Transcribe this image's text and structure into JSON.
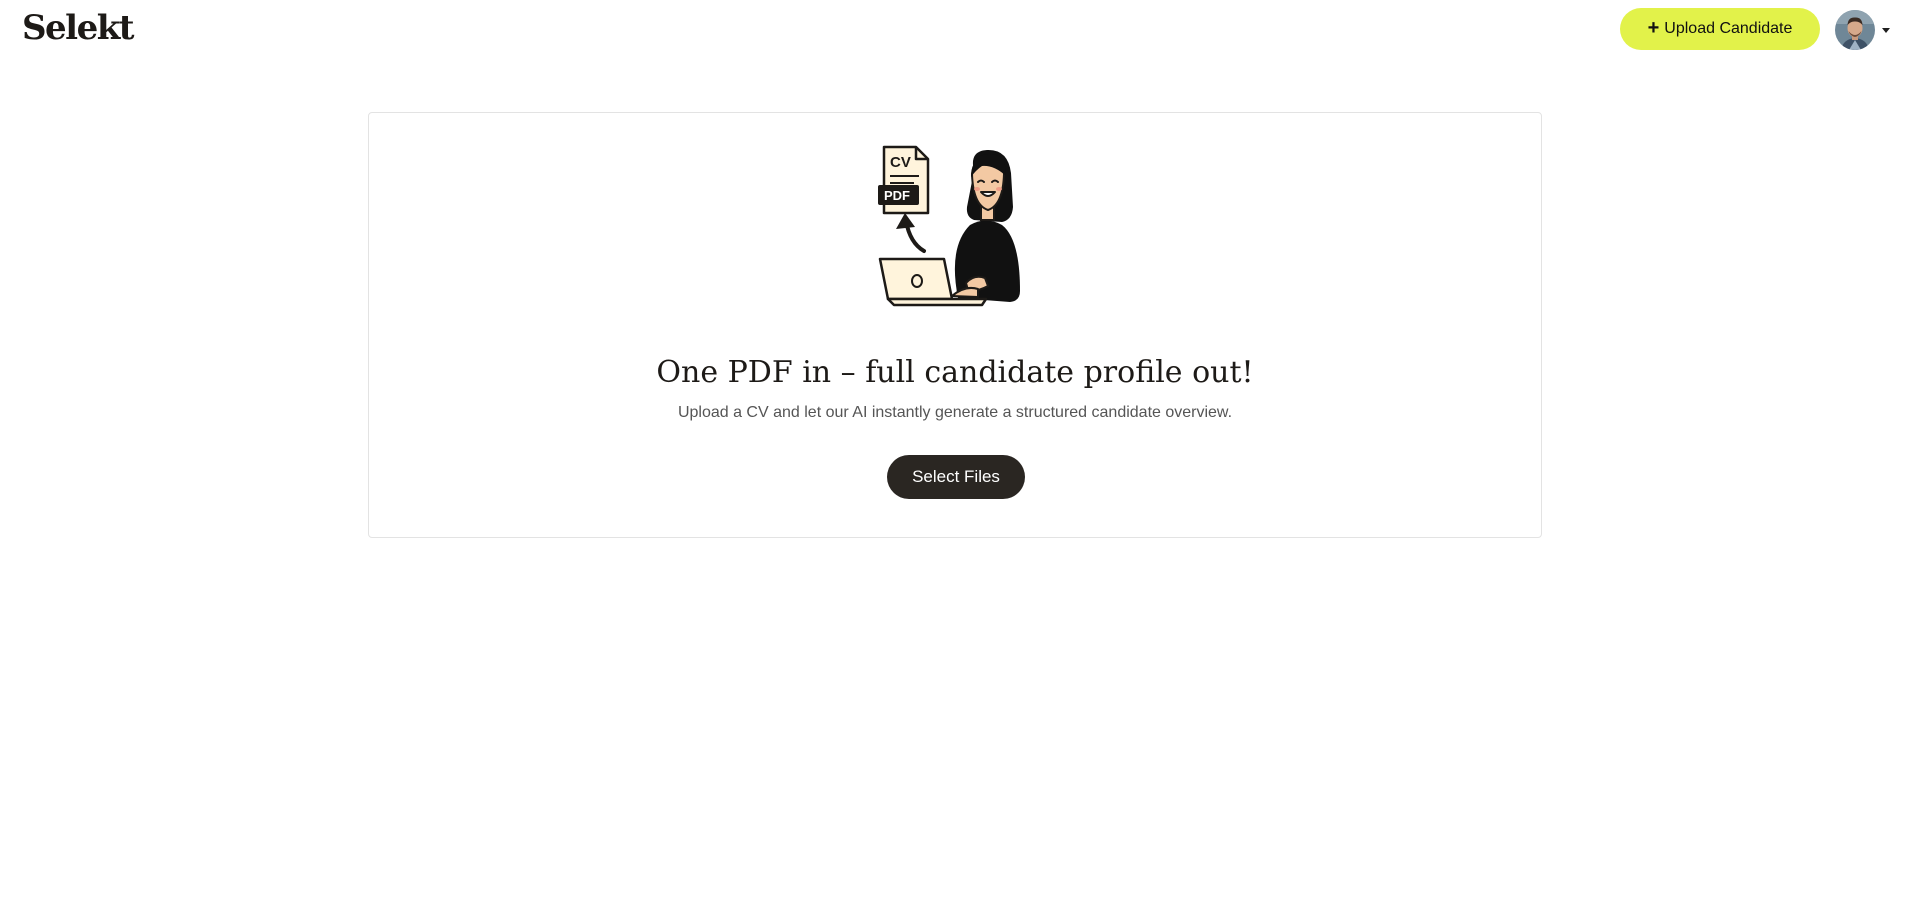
{
  "header": {
    "logo": "Selekt",
    "upload_button_label": "Upload Candidate",
    "upload_button_icon": "plus-icon",
    "accent_color": "#e2f24a"
  },
  "empty_state": {
    "illustration_labels": {
      "cv": "CV",
      "pdf": "PDF"
    },
    "title": "One PDF in – full candidate profile out!",
    "description": "Upload a CV and let our AI instantly generate a structured candidate overview.",
    "select_button_label": "Select Files",
    "button_color": "#2a2622"
  }
}
